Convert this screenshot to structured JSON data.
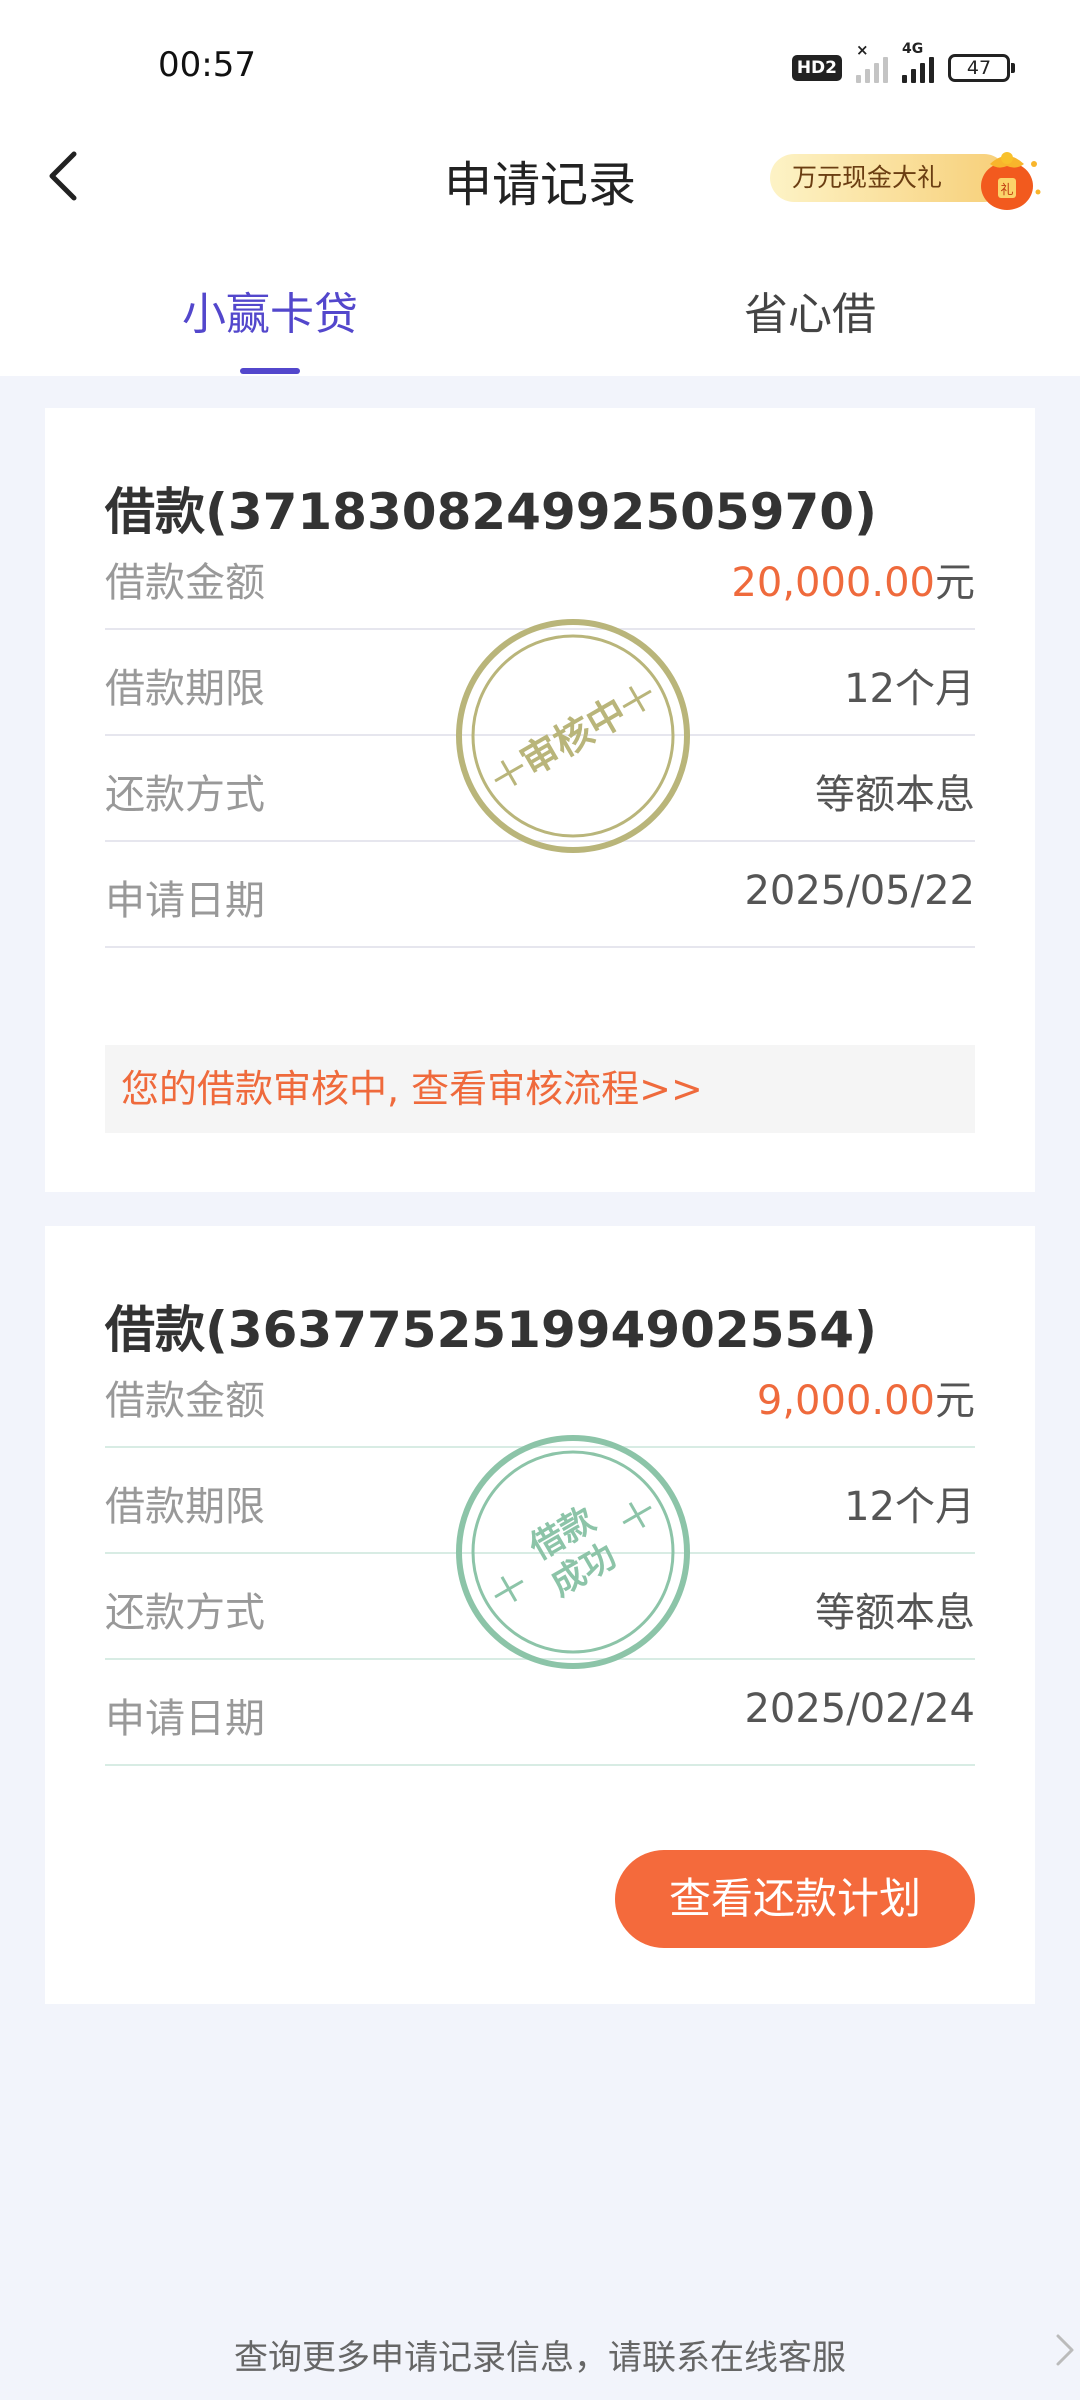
{
  "status_bar": {
    "time": "00:57",
    "hd": "HD2",
    "network": "4G",
    "battery": "47"
  },
  "header": {
    "title": "申请记录",
    "promo_label": "万元现金大礼",
    "gift_char": "礼"
  },
  "tabs": [
    {
      "label": "小赢卡贷",
      "active": true
    },
    {
      "label": "省心借",
      "active": false
    }
  ],
  "records": [
    {
      "title": "借款(371830824992505970)",
      "amount": "20,000.00",
      "unit": "元",
      "stamp_text": "审核中",
      "stamp_color": "#b9b57a",
      "rows": [
        {
          "label": "借款金额"
        },
        {
          "label": "借款期限",
          "value": "12个月"
        },
        {
          "label": "还款方式",
          "value": "等额本息"
        },
        {
          "label": "申请日期",
          "value": "2025/05/22"
        }
      ],
      "notice": "您的借款审核中, 查看审核流程>>"
    },
    {
      "title": "借款(363775251994902554)",
      "amount": "9,000.00",
      "unit": "元",
      "stamp_line1": "借款",
      "stamp_line2": "成功",
      "stamp_color": "#8cc4a8",
      "rows": [
        {
          "label": "借款金额"
        },
        {
          "label": "借款期限",
          "value": "12个月"
        },
        {
          "label": "还款方式",
          "value": "等额本息"
        },
        {
          "label": "申请日期",
          "value": "2025/02/24"
        }
      ],
      "button_label": "查看还款计划"
    }
  ],
  "footer": {
    "text": "查询更多申请记录信息，请联系在线客服"
  },
  "colors": {
    "accent": "#5347cc",
    "orange": "#f46a3c",
    "background": "#f2f4fb"
  }
}
